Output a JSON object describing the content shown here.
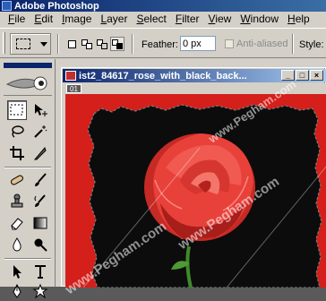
{
  "app": {
    "title": "Adobe Photoshop"
  },
  "menu": [
    {
      "label": "File",
      "key": "F",
      "rest": "ile"
    },
    {
      "label": "Edit",
      "key": "E",
      "rest": "dit"
    },
    {
      "label": "Image",
      "key": "I",
      "rest": "mage"
    },
    {
      "label": "Layer",
      "key": "L",
      "rest": "ayer"
    },
    {
      "label": "Select",
      "key": "S",
      "rest": "elect"
    },
    {
      "label": "Filter",
      "key": "F",
      "rest": "ilter"
    },
    {
      "label": "View",
      "key": "V",
      "rest": "iew"
    },
    {
      "label": "Window",
      "key": "W",
      "rest": "indow"
    },
    {
      "label": "Help",
      "key": "H",
      "rest": "elp"
    }
  ],
  "options": {
    "feather_label": "Feather:",
    "feather_value": "0 px",
    "antialiased_label": "Anti-aliased",
    "style_label": "Style:"
  },
  "document": {
    "title": "ist2_84617_rose_with_black_back...",
    "tab": "01",
    "canvas_color": "#d41f1a"
  },
  "watermarks": [
    "www.Pegham.com",
    "www.Pegham.com",
    "www.Pegham.com"
  ],
  "colors": {
    "title_bar_start": "#0a246a",
    "chrome": "#d4d0c8",
    "rose": "#e8413a",
    "background_dark": "#0c0c0c"
  }
}
